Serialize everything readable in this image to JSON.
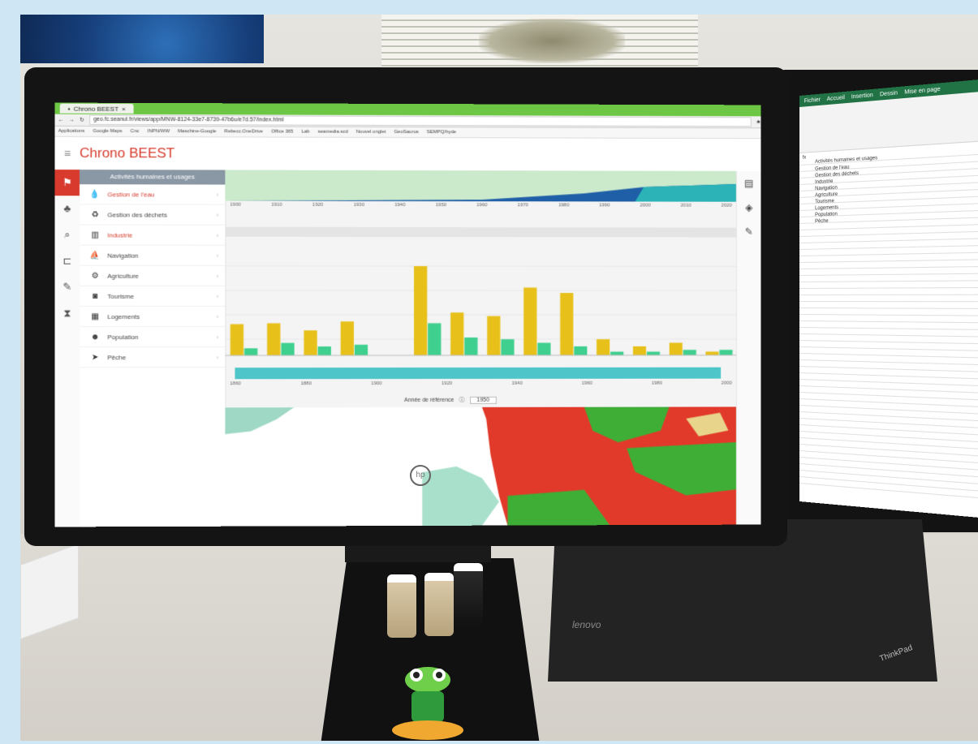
{
  "browser": {
    "tab_title": "Chrono BEEST",
    "url": "geo.fc.seanul.fr/views/app/MNW-8124-33e7-8739-47b6u/e7d.57/index.html",
    "bookmarks": [
      "Applications",
      "Google Maps",
      "Cnc",
      "INPN/WW",
      "Maschine-Google",
      "Rebecc.OneDrive",
      "Office 365",
      "Lab",
      "seamedia.scd",
      "Nouvel onglet",
      "GeoSaurus",
      "SEMPQ/hyde"
    ]
  },
  "app": {
    "title": "Chrono BEEST",
    "menu_header": "Activités humaines et usages",
    "menu_items": [
      {
        "label": "Gestion de l'eau",
        "icon": "water-drop-icon"
      },
      {
        "label": "Gestion des déchets",
        "icon": "recycle-icon"
      },
      {
        "label": "Industrie",
        "icon": "factory-icon"
      },
      {
        "label": "Navigation",
        "icon": "boat-icon"
      },
      {
        "label": "Agriculture",
        "icon": "tractor-icon"
      },
      {
        "label": "Tourisme",
        "icon": "camera-icon"
      },
      {
        "label": "Logements",
        "icon": "buildings-icon"
      },
      {
        "label": "Population",
        "icon": "people-icon"
      },
      {
        "label": "Pêche",
        "icon": "fish-icon"
      }
    ],
    "top_axis_ticks": [
      "1900",
      "1910",
      "1920",
      "1930",
      "1940",
      "1950",
      "1960",
      "1970",
      "1980",
      "1990",
      "2000",
      "2010",
      "2020"
    ],
    "slider_ticks": [
      "1860",
      "1880",
      "1900",
      "1920",
      "1940",
      "1960",
      "1980",
      "2000"
    ],
    "ref_year_label": "Année de référence",
    "ref_year_value": "1950"
  },
  "chart_data": {
    "type": "bar",
    "series": [
      {
        "color": "#e7c11a",
        "values": [
          35,
          36,
          28,
          38,
          0,
          100,
          48,
          44,
          76,
          70,
          18,
          10,
          14,
          4
        ]
      },
      {
        "color": "#3fcf8e",
        "values": [
          8,
          14,
          10,
          12,
          0,
          36,
          20,
          18,
          14,
          10,
          4,
          4,
          6,
          6
        ]
      }
    ]
  },
  "excel": {
    "tabs": [
      "Fichier",
      "Accueil",
      "Insertion",
      "Dessin",
      "Mise en page"
    ],
    "column_header": "Activités humaines et usages",
    "rows": [
      "Activités humaines et usages",
      "Gestion de l'eau",
      "Gestion des déchets",
      "Industrie",
      "Navigation",
      "Agriculture",
      "Tourisme",
      "Logements",
      "Population",
      "Pêche"
    ]
  },
  "laptop_brand": "lenovo",
  "laptop_model": "ThinkPad",
  "colors": {
    "accent": "#d83b2e",
    "excel_green": "#217346",
    "map_red": "#e23a2a",
    "map_green": "#3fae36"
  }
}
